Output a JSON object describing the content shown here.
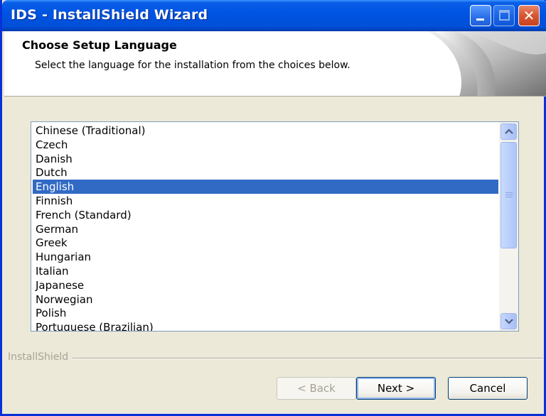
{
  "window": {
    "title": "IDS - InstallShield Wizard",
    "controls": {
      "minimize": "minimize-icon",
      "maximize": "maximize-icon",
      "close": "✕"
    }
  },
  "header": {
    "title": "Choose Setup Language",
    "subtitle": "Select the language for the installation from the choices below."
  },
  "languages": {
    "items": [
      "Chinese (Traditional)",
      "Czech",
      "Danish",
      "Dutch",
      "English",
      "Finnish",
      "French (Standard)",
      "German",
      "Greek",
      "Hungarian",
      "Italian",
      "Japanese",
      "Norwegian",
      "Polish",
      "Portuguese (Brazilian)"
    ],
    "selected": "English"
  },
  "brand": {
    "text": "InstallShield"
  },
  "buttons": {
    "back": "< Back",
    "next": "Next >",
    "cancel": "Cancel"
  },
  "colors": {
    "titlebar": "#0054e3",
    "selection": "#316ac5",
    "dialog_bg": "#ece9d8"
  }
}
